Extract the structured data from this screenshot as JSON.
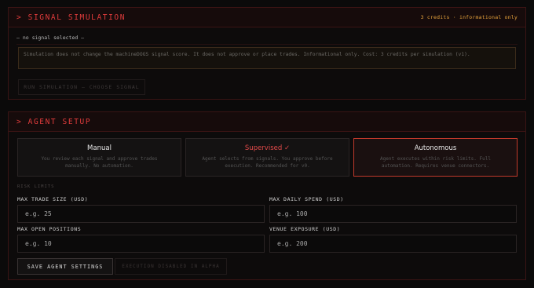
{
  "signal_panel": {
    "title": "> SIGNAL SIMULATION",
    "meta": "3 credits · informational only",
    "selected": "— no signal selected —",
    "notice": "Simulation does not change the machineDOGS signal score. It does not approve or place trades. Informational only. Cost: 3 credits per simulation (v1).",
    "run_button": "RUN SIMULATION — CHOOSE SIGNAL"
  },
  "agent_panel": {
    "title": "> AGENT SETUP",
    "modes": [
      {
        "title": "Manual",
        "desc": "You review each signal and approve trades manually. No automation.",
        "selected": false,
        "accent": false
      },
      {
        "title": "Supervised ✓",
        "desc": "Agent selects from signals. You approve before execution. Recommended for v0.",
        "selected": false,
        "accent": true
      },
      {
        "title": "Autonomous",
        "desc": "Agent executes within risk limits. Full automation. Requires venue connectors.",
        "selected": true,
        "accent": false
      }
    ],
    "risk_label": "RISK LIMITS",
    "fields": {
      "max_trade_size": {
        "label": "MAX TRADE SIZE (USD)",
        "placeholder": "e.g. 25"
      },
      "max_daily_spend": {
        "label": "MAX DAILY SPEND (USD)",
        "placeholder": "e.g. 100"
      },
      "max_open_positions": {
        "label": "MAX OPEN POSITIONS",
        "placeholder": "e.g. 10"
      },
      "venue_exposure": {
        "label": "VENUE EXPOSURE (USD)",
        "placeholder": "e.g. 200"
      }
    },
    "save_button": "SAVE AGENT SETTINGS",
    "exec_button": "EXECUTION DISABLED IN ALPHA"
  },
  "colors": {
    "accent": "#e23c3c",
    "meta": "#e6a23c",
    "background": "#0b0a0a"
  }
}
